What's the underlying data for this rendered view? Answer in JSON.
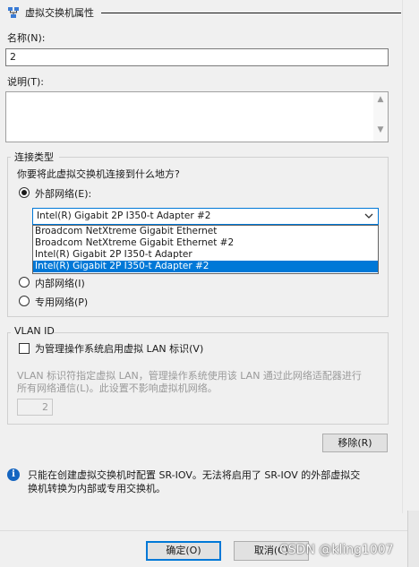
{
  "section": {
    "title": "虚拟交换机属性"
  },
  "name_field": {
    "label": "名称(N):",
    "value": "2"
  },
  "notes_field": {
    "label": "说明(T):",
    "value": ""
  },
  "connection": {
    "group_label": "连接类型",
    "question": "你要将此虚拟交换机连接到什么地方?",
    "external_label": "外部网络(E):",
    "internal_label": "内部网络(I)",
    "private_label": "专用网络(P)",
    "selected_type": "external",
    "adapter_selected": "Intel(R) Gigabit 2P I350-t Adapter #2",
    "adapter_options": [
      "Broadcom NetXtreme Gigabit Ethernet",
      "Broadcom NetXtreme Gigabit Ethernet #2",
      "Intel(R) Gigabit 2P I350-t Adapter",
      "Intel(R) Gigabit 2P I350-t Adapter #2"
    ]
  },
  "vlan": {
    "group_label": "VLAN ID",
    "checkbox_label": "为管理操作系统启用虚拟 LAN 标识(V)",
    "checked": false,
    "description_line1": "VLAN 标识符指定虚拟 LAN，管理操作系统使用该 LAN 通过此网络适配器进行",
    "description_line2": "所有网络通信(L)。此设置不影响虚拟机网络。",
    "vlan_value": "2"
  },
  "remove_button": "移除(R)",
  "info": {
    "line1": "只能在创建虚拟交换机时配置 SR-IOV。无法将启用了 SR-IOV 的外部虚拟交",
    "line2": "换机转换为内部或专用交换机。"
  },
  "footer": {
    "ok": "确定(O)",
    "cancel": "取消(C)"
  },
  "watermark": "CSDN @kling1007",
  "colors": {
    "accent": "#0078d7",
    "info": "#1565c0",
    "background": "#f0f0f0"
  }
}
